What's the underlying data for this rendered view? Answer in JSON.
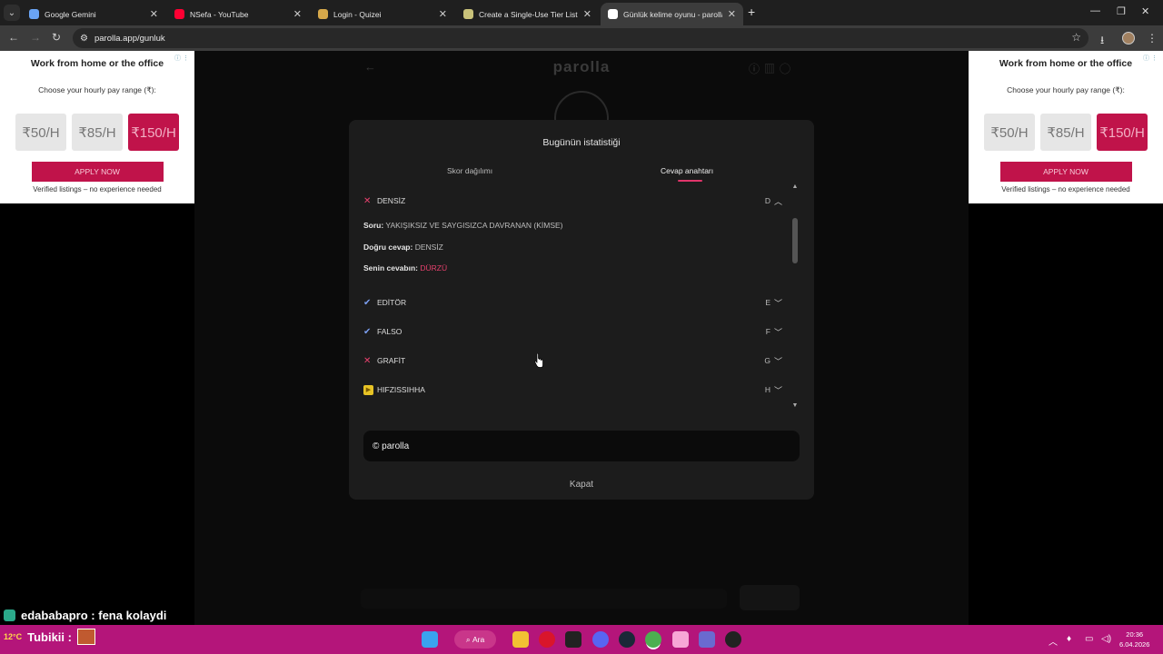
{
  "browser": {
    "tabs": [
      {
        "title": "Google Gemini",
        "favicon_color": "#6aa4f5",
        "active": false
      },
      {
        "title": "NSefa - YouTube",
        "favicon_color": "#ff0033",
        "active": false
      },
      {
        "title": "Login - Quizei",
        "favicon_color": "#d6a84a",
        "active": false
      },
      {
        "title": "Create a Single-Use Tier List (P",
        "favicon_color": "#c9c27a",
        "active": false
      },
      {
        "title": "Günlük kelime oyunu - parolla",
        "favicon_color": "#ffffff",
        "active": true
      }
    ],
    "url": "parolla.app/gunluk"
  },
  "ads": {
    "title": "Work from home or the office",
    "subtitle": "Choose your hourly pay range (₹):",
    "rates": [
      "₹50/H",
      "₹85/H",
      "₹150/H"
    ],
    "apply_label": "APPLY NOW",
    "verified_text": "Verified listings – no experience needed"
  },
  "background": {
    "logo": "parolla"
  },
  "modal": {
    "title": "Bugünün istatistiği",
    "tabs": [
      "Skor dağılımı",
      "Cevap anahtarı"
    ],
    "expanded": {
      "word": "DENSİZ",
      "letter": "D",
      "question_label": "Soru:",
      "question": "YAKIŞIKSIZ VE SAYGISIZCA DAVRANAN (KİMSE)",
      "correct_label": "Doğru cevap:",
      "correct": "DENSİZ",
      "yours_label": "Senin cevabın:",
      "yours": "DÜRZÜ"
    },
    "answers": [
      {
        "word": "EDİTÖR",
        "letter": "E",
        "status": "correct"
      },
      {
        "word": "FALSO",
        "letter": "F",
        "status": "correct"
      },
      {
        "word": "GRAFİT",
        "letter": "G",
        "status": "wrong"
      },
      {
        "word": "HIFZISSIHHA",
        "letter": "H",
        "status": "skipped"
      }
    ],
    "brand": "© parolla",
    "close_label": "Kapat",
    "accent": "#e0356a"
  },
  "stream": {
    "chat_user": "edababapro",
    "chat_message": "fena kolaydi",
    "streamer": "Tubikii :",
    "weather": "12°C"
  },
  "taskbar": {
    "search_label": "Ara",
    "time": "20:36",
    "date": "6.04.2026"
  }
}
